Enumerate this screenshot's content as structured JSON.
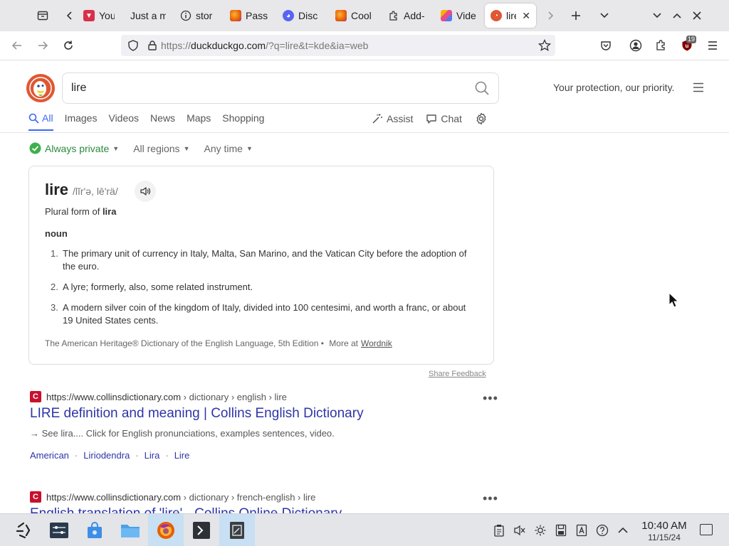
{
  "browser": {
    "tabs": [
      {
        "label": "YouT",
        "icon": "youtube-icon",
        "color": "#d9304a"
      },
      {
        "label": "Just a m",
        "icon": "none",
        "color": ""
      },
      {
        "label": "stor",
        "icon": "info-icon",
        "color": "#333"
      },
      {
        "label": "Pass",
        "icon": "firefox-icon",
        "color": "#e66000"
      },
      {
        "label": "Disc",
        "icon": "discord-icon",
        "color": "#5865f2"
      },
      {
        "label": "Cool",
        "icon": "firefox-icon",
        "color": "#e66000"
      },
      {
        "label": "Add-",
        "icon": "puzzle-icon",
        "color": "#333"
      },
      {
        "label": "Vide",
        "icon": "video-icon",
        "color": "#8e44ad"
      },
      {
        "label": "lire",
        "icon": "duckduckgo-icon",
        "color": "#de5833"
      }
    ],
    "url": {
      "prefix": "https://",
      "host": "duckduckgo.com",
      "path": "/?q=lire&t=kde&ia=web"
    },
    "extension_badge": "19"
  },
  "search": {
    "query": "lire",
    "tagline": "Your protection, our priority."
  },
  "vertical_tabs": [
    "All",
    "Images",
    "Videos",
    "News",
    "Maps",
    "Shopping"
  ],
  "tools": {
    "assist": "Assist",
    "chat": "Chat"
  },
  "filters": {
    "privacy": "Always private",
    "region": "All regions",
    "time": "Any time"
  },
  "dictionary": {
    "word": "lire",
    "pronunciation": "/lĭrʹə, lēʹrä/",
    "plural_prefix": "Plural form of",
    "plural_of": "lira",
    "part_of_speech": "noun",
    "definitions": [
      {
        "num": "1.",
        "text": "The primary unit of currency in Italy, Malta, San Marino, and the Vatican City before the adoption of the euro."
      },
      {
        "num": "2.",
        "text": "A lyre; formerly, also, some related instrument."
      },
      {
        "num": "3.",
        "text": "A modern silver coin of the kingdom of Italy, divided into 100 centesimi, and worth a franc, or about 19 United States cents."
      }
    ],
    "source": "The American Heritage® Dictionary of the English Language, 5th Edition •",
    "more_at": "More at",
    "more_link": "Wordnik",
    "share_feedback": "Share Feedback"
  },
  "results": [
    {
      "favicon": "C",
      "url_host": "https://www.collinsdictionary.com",
      "url_path": " › dictionary › english › lire",
      "title": "LIRE definition and meaning | Collins English Dictionary",
      "snippet": "→ See lira.... Click for English pronunciations, examples sentences, video.",
      "links": [
        "American",
        "Liriodendra",
        "Lira",
        "Lire"
      ]
    },
    {
      "favicon": "C",
      "url_host": "https://www.collinsdictionary.com",
      "url_path": " › dictionary › french-english › lire",
      "title": "English translation of 'lire' - Collins Online Dictionary"
    }
  ],
  "taskbar": {
    "time": "10:40 AM",
    "date": "11/15/24"
  }
}
